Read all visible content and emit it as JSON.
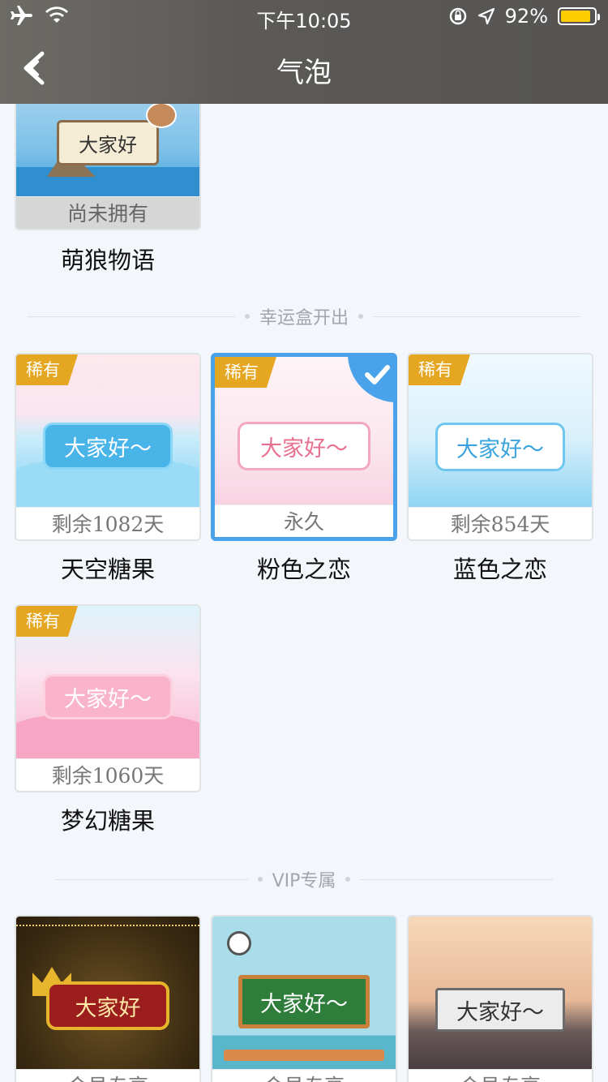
{
  "status_bar": {
    "time": "下午10:05",
    "battery": "92%"
  },
  "nav": {
    "title": "气泡"
  },
  "bubble_text": "大家好",
  "bubble_text_tilde": "大家好～",
  "top_item": {
    "status": "尚未拥有",
    "name": "萌狼物语"
  },
  "sections": {
    "lucky_box": "幸运盒开出",
    "vip": "VIP专属"
  },
  "rare_badge": "稀有",
  "lucky_items": [
    {
      "name": "天空糖果",
      "status": "剩余1082天"
    },
    {
      "name": "粉色之恋",
      "status": "永久"
    },
    {
      "name": "蓝色之恋",
      "status": "剩余854天"
    },
    {
      "name": "梦幻糖果",
      "status": "剩余1060天"
    }
  ],
  "vip_items": [
    {
      "status": "会员专享"
    },
    {
      "status": "会员专享"
    },
    {
      "status": "会员专享"
    }
  ]
}
